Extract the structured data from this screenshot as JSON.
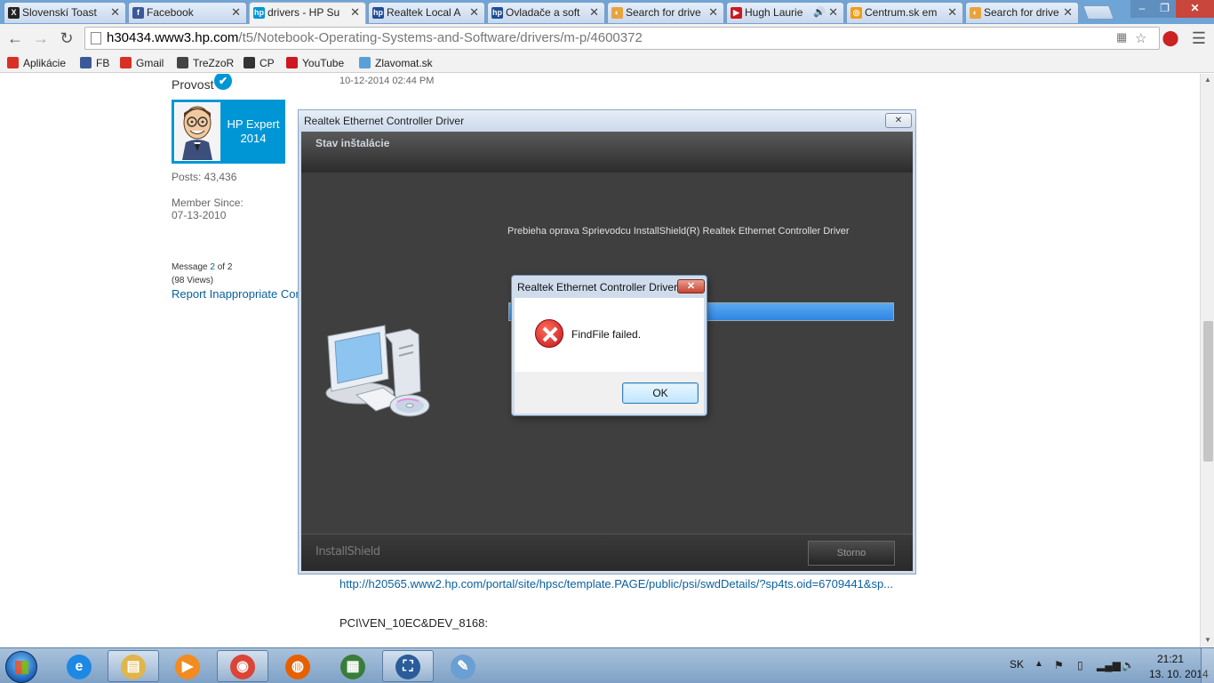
{
  "browser": {
    "tabs": [
      {
        "title": "Slovenskí Toast",
        "favicon_color": "#222222",
        "favicon_glyph": "X",
        "active": false
      },
      {
        "title": "Facebook",
        "favicon_color": "#3b5998",
        "favicon_glyph": "f",
        "active": false
      },
      {
        "title": "drivers - HP Su",
        "favicon_color": "#0096d6",
        "favicon_glyph": "hp",
        "active": true
      },
      {
        "title": "Realtek Local A",
        "favicon_color": "#1f4e96",
        "favicon_glyph": "hp",
        "active": false
      },
      {
        "title": "Ovladače a soft",
        "favicon_color": "#1f4e96",
        "favicon_glyph": "hp",
        "active": false
      },
      {
        "title": "Search for drive",
        "favicon_color": "#e8a33c",
        "favicon_glyph": "◐",
        "active": false
      },
      {
        "title": "Hugh Laurie",
        "favicon_color": "#cc181e",
        "favicon_glyph": "▶",
        "active": false,
        "playing_audio": true
      },
      {
        "title": "Centrum.sk em",
        "favicon_color": "#f39c12",
        "favicon_glyph": "◎",
        "active": false
      },
      {
        "title": "Search for drive",
        "favicon_color": "#e8a33c",
        "favicon_glyph": "◐",
        "active": false
      }
    ],
    "url_host": "h30434.www3.hp.com",
    "url_path": "/t5/Notebook-Operating-Systems-and-Software/drivers/m-p/4600372",
    "bookmarks": [
      {
        "label": "Aplikácie",
        "icon": "apps-grid-icon",
        "color": "#d93025"
      },
      {
        "label": "FB",
        "icon": "facebook-icon",
        "color": "#3b5998"
      },
      {
        "label": "Gmail",
        "icon": "gmail-icon",
        "color": "#d93025"
      },
      {
        "label": "TreZzoR",
        "icon": "trezzor-icon",
        "color": "#444444"
      },
      {
        "label": "CP",
        "icon": "cp-icon",
        "color": "#333333"
      },
      {
        "label": "YouTube",
        "icon": "youtube-icon",
        "color": "#cc181e"
      },
      {
        "label": "Zlavomat.sk",
        "icon": "zlavomat-icon",
        "color": "#5aa0d8"
      }
    ]
  },
  "page": {
    "username": "Provost",
    "expert_label": "HP Expert 2014",
    "posts": "Posts: 43,436",
    "member_since_label": "Member Since:",
    "member_since": "07-13-2010",
    "message_prefix": "Message",
    "message_num": "2",
    "message_suffix": "of 2",
    "views": "(98 Views)",
    "report_link": "Report Inappropriate Con",
    "post_date": "10-12-2014 02:44 PM",
    "driver_url": "http://h20565.www2.hp.com/portal/site/hpsc/template.PAGE/public/psi/swdDetails/?sp4ts.oid=6709441&sp...",
    "pci_id": "PCI\\VEN_10EC&DEV_8168:"
  },
  "installer": {
    "title": "Realtek Ethernet Controller Driver",
    "step": "Stav inštalácie",
    "status": "Prebieha oprava Sprievodcu InstallShield(R) Realtek Ethernet Controller Driver",
    "progress_percent": 100,
    "logo": "InstallShield",
    "cancel_label": "Storno"
  },
  "error_dialog": {
    "title": "Realtek Ethernet Controller Driver",
    "message": "FindFile failed.",
    "ok_label": "OK"
  },
  "taskbar": {
    "apps": [
      {
        "name": "internet-explorer",
        "color": "#1e88e5",
        "glyph": "e",
        "running": false
      },
      {
        "name": "windows-explorer",
        "color": "#e0b54a",
        "glyph": "▤",
        "running": true
      },
      {
        "name": "media-player",
        "color": "#f28b20",
        "glyph": "▶",
        "running": false
      },
      {
        "name": "chrome",
        "color": "#db4437",
        "glyph": "◉",
        "running": true
      },
      {
        "name": "firefox",
        "color": "#e66000",
        "glyph": "◍",
        "running": false
      },
      {
        "name": "task-manager",
        "color": "#3a7d3a",
        "glyph": "▦",
        "running": false
      },
      {
        "name": "installshield",
        "color": "#2b5c9a",
        "glyph": "⛶",
        "running": true
      },
      {
        "name": "paint",
        "color": "#6a9fd4",
        "glyph": "✎",
        "running": false
      }
    ],
    "language": "SK",
    "time": "21:21",
    "date": "13. 10. 2014"
  }
}
